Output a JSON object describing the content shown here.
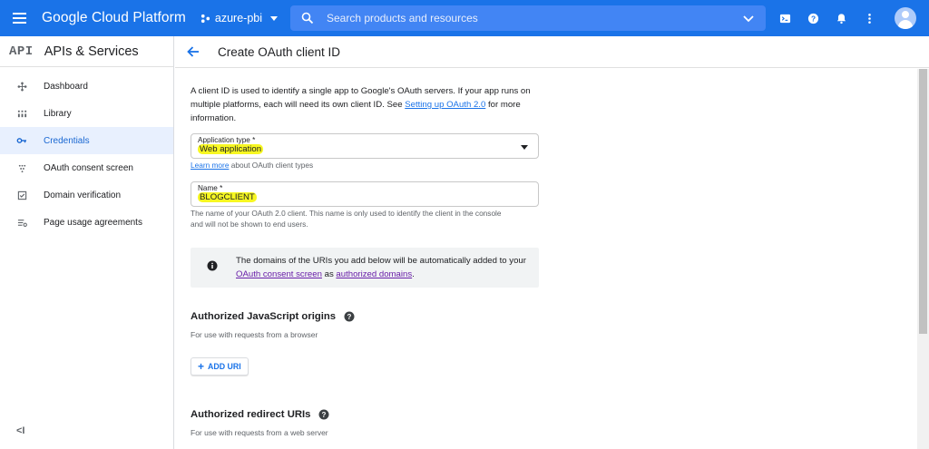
{
  "topbar": {
    "brand": "Google Cloud Platform",
    "project": "azure-pbi",
    "search_placeholder": "Search products and resources",
    "icons": [
      "cloud-shell-icon",
      "help-icon",
      "notifications-icon",
      "more-vert-icon",
      "account-avatar"
    ]
  },
  "sidebar": {
    "logo": "API",
    "title": "APIs & Services",
    "items": [
      {
        "label": "Dashboard",
        "icon": "dashboard-icon"
      },
      {
        "label": "Library",
        "icon": "library-icon"
      },
      {
        "label": "Credentials",
        "icon": "key-icon",
        "active": true
      },
      {
        "label": "OAuth consent screen",
        "icon": "consent-icon"
      },
      {
        "label": "Domain verification",
        "icon": "checkbox-icon"
      },
      {
        "label": "Page usage agreements",
        "icon": "settings-list-icon"
      }
    ],
    "collapse": "<I"
  },
  "header": {
    "title": "Create OAuth client ID"
  },
  "form": {
    "intro_text": "A client ID is used to identify a single app to Google's OAuth servers. If your app runs on multiple platforms, each will need its own client ID. See ",
    "intro_link": "Setting up OAuth 2.0",
    "intro_tail": " for more information.",
    "app_type_label": "Application type *",
    "app_type_value": "Web application",
    "learn_more_link": "Learn more",
    "learn_more_tail": " about OAuth client types",
    "name_label": "Name *",
    "name_value": "BLOGCLIENT",
    "name_helper": "The name of your OAuth 2.0 client. This name is only used to identify the client in the console and will not be shown to end users.",
    "info_text_1": "The domains of the URIs you add below will be automatically added to your ",
    "info_link_1": "OAuth consent screen",
    "info_mid": " as ",
    "info_link_2": "authorized domains",
    "info_end": ".",
    "js_origins_title": "Authorized JavaScript origins",
    "js_origins_sub": "For use with requests from a browser",
    "add_uri": "ADD URI",
    "redirect_title": "Authorized redirect URIs",
    "redirect_sub": "For use with requests from a web server"
  },
  "colors": {
    "topbar": "#1a73e8",
    "highlight": "#f7f722",
    "link": "#1a73e8",
    "visited_link": "#681da8"
  }
}
